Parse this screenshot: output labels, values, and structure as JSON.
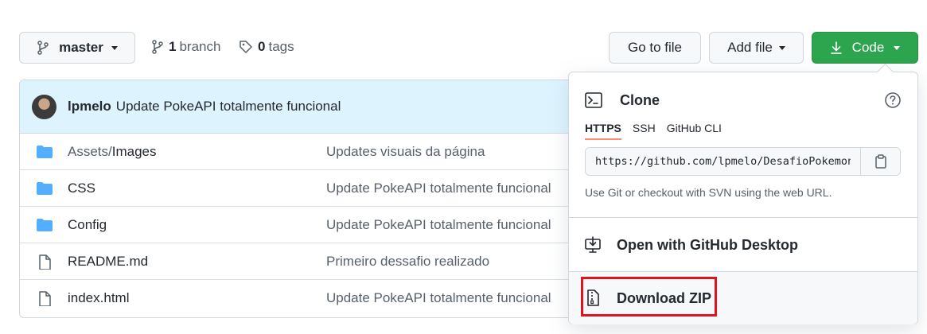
{
  "toolbar": {
    "branch_button": "master",
    "branches_count": "1",
    "branches_label": "branch",
    "tags_count": "0",
    "tags_label": "tags",
    "go_to_file": "Go to file",
    "add_file": "Add file",
    "code": "Code",
    "code_color": "#2da44e"
  },
  "commit": {
    "author": "lpmelo",
    "message": "Update PokeAPI totalmente funcional"
  },
  "files": [
    {
      "icon": "folder-icon",
      "name_dim": "Assets/",
      "name": "Images",
      "message": "Updates visuais da página"
    },
    {
      "icon": "folder-icon",
      "name_dim": "",
      "name": "CSS",
      "message": "Update PokeAPI totalmente funcional"
    },
    {
      "icon": "folder-icon",
      "name_dim": "",
      "name": "Config",
      "message": "Update PokeAPI totalmente funcional"
    },
    {
      "icon": "file-icon",
      "name_dim": "",
      "name": "README.md",
      "message": "Primeiro dessafio realizado"
    },
    {
      "icon": "file-icon",
      "name_dim": "",
      "name": "index.html",
      "message": "Update PokeAPI totalmente funcional"
    }
  ],
  "clone_menu": {
    "title": "Clone",
    "tabs": [
      "HTTPS",
      "SSH",
      "GitHub CLI"
    ],
    "active_tab": "HTTPS",
    "url": "https://github.com/lpmelo/DesafioPokemon.git",
    "hint": "Use Git or checkout with SVN using the web URL.",
    "open_desktop": "Open with GitHub Desktop",
    "download_zip": "Download ZIP",
    "highlight_color": "#e0141e"
  }
}
